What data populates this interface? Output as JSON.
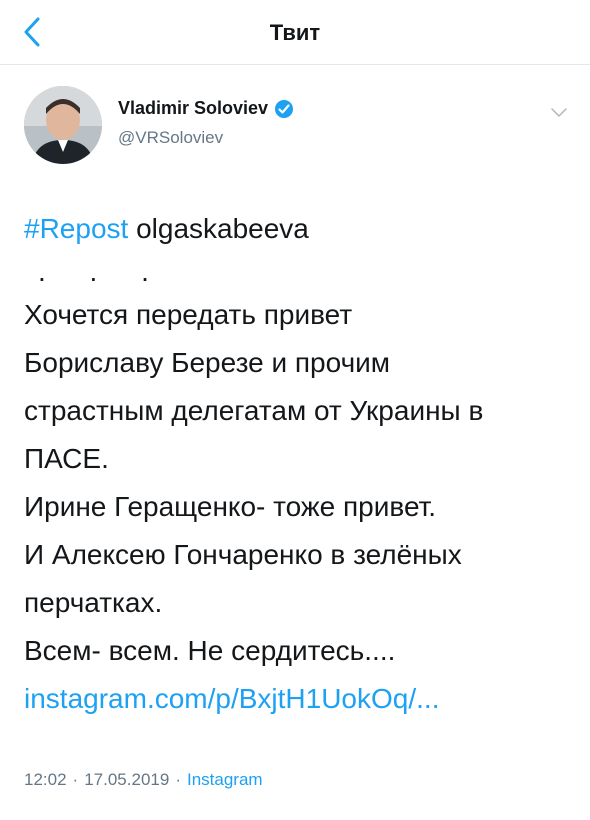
{
  "nav": {
    "title": "Твит"
  },
  "author": {
    "name": "Vladimir Soloviev",
    "handle": "@VRSoloviev"
  },
  "tweet": {
    "hashtag": "#Repost",
    "repost_user": "olgaskabeeva",
    "dots": ". . .",
    "lines": [
      "Хочется передать привет",
      "Бориславу Березе и прочим",
      "страстным делегатам от Украины в",
      "ПАСЕ.",
      "Ирине Геращенко- тоже привет.",
      "И Алексею Гончаренко в зелёных",
      "перчатках.",
      "Всем- всем. Не сердитесь...."
    ],
    "link": "instagram.com/p/BxjtH1UokOq/..."
  },
  "meta": {
    "time": "12:02",
    "separator1": "·",
    "date": "17.05.2019",
    "separator2": "·",
    "source": "Instagram"
  },
  "colors": {
    "accent": "#1da1f2",
    "secondary_text": "#657786",
    "primary_text": "#14171a"
  }
}
